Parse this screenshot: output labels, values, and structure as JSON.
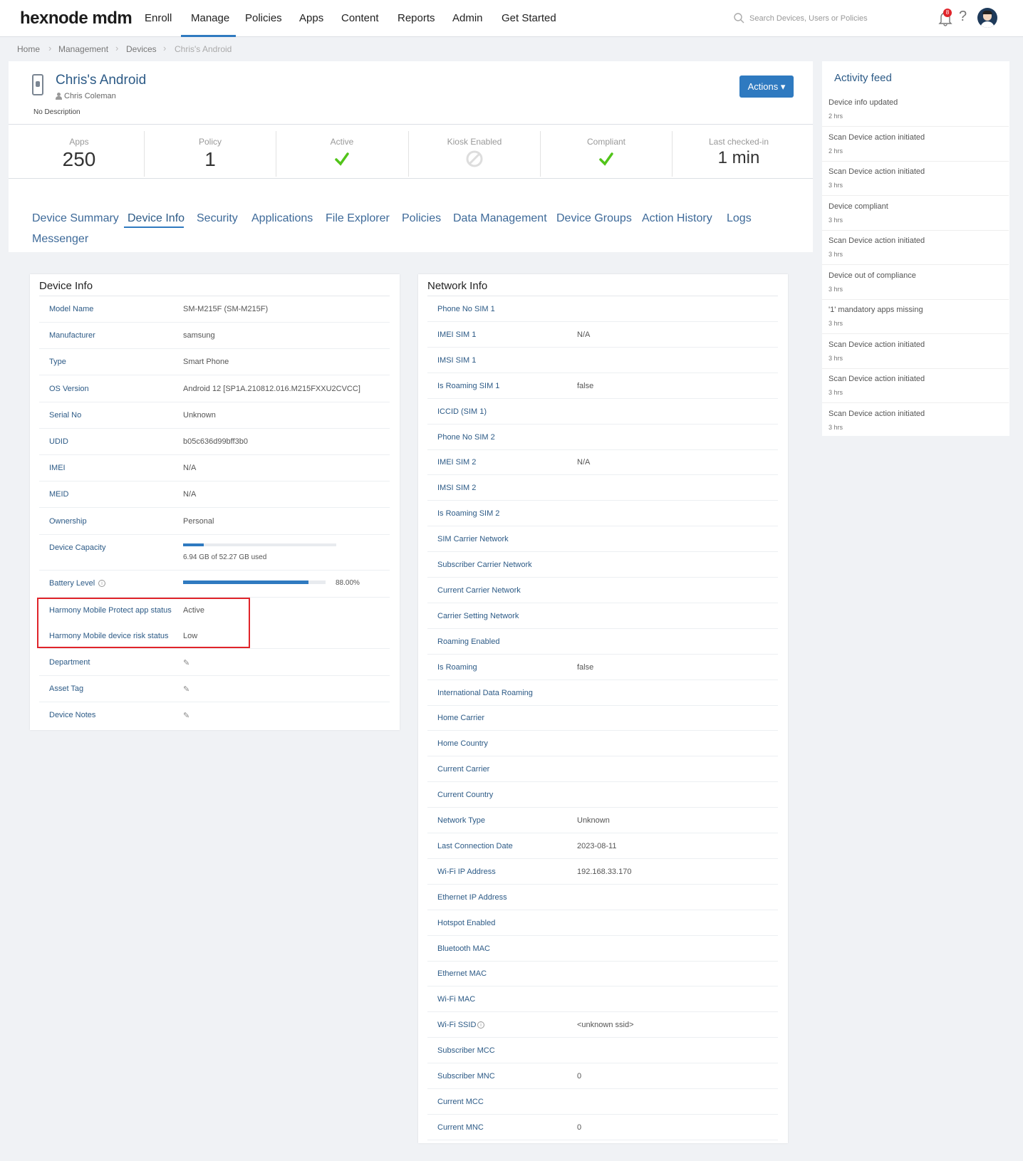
{
  "nav": {
    "logo": "hexnode mdm",
    "menu": [
      "Enroll",
      "Manage",
      "Policies",
      "Apps",
      "Content",
      "Reports",
      "Admin",
      "Get Started"
    ],
    "search_placeholder": "Search Devices, Users or Policies",
    "notification_count": "8"
  },
  "breadcrumb": [
    "Home",
    "Management",
    "Devices",
    "Chris's Android"
  ],
  "device": {
    "name": "Chris's Android",
    "user": "Chris Coleman",
    "description": "No Description",
    "actions_label": "Actions"
  },
  "stats": {
    "apps_label": "Apps",
    "apps_value": "250",
    "policy_label": "Policy",
    "policy_value": "1",
    "active_label": "Active",
    "kiosk_label": "Kiosk Enabled",
    "compliant_label": "Compliant",
    "checked_label": "Last checked-in",
    "checked_value": "1 min"
  },
  "tabs": [
    "Device Summary",
    "Device Info",
    "Security",
    "Applications",
    "File Explorer",
    "Policies",
    "Data Management",
    "Device Groups",
    "Action History",
    "Logs",
    "Messenger"
  ],
  "device_info": {
    "title": "Device Info",
    "rows": [
      {
        "k": "Model Name",
        "v": "SM-M215F (SM-M215F)"
      },
      {
        "k": "Manufacturer",
        "v": "samsung"
      },
      {
        "k": "Type",
        "v": "Smart Phone"
      },
      {
        "k": "OS Version",
        "v": "Android 12 [SP1A.210812.016.M215FXXU2CVCC]"
      },
      {
        "k": "Serial No",
        "v": "Unknown"
      },
      {
        "k": "UDID",
        "v": "b05c636d99bff3b0"
      },
      {
        "k": "IMEI",
        "v": "N/A"
      },
      {
        "k": "MEID",
        "v": "N/A"
      },
      {
        "k": "Ownership",
        "v": "Personal"
      }
    ],
    "capacity_label": "Device Capacity",
    "capacity_text": "6.94 GB of 52.27 GB used",
    "capacity_fraction": 0.133,
    "battery_label": "Battery Level",
    "battery_text": "88.00%",
    "battery_fraction": 0.88,
    "harmony_app_label": "Harmony Mobile Protect app status",
    "harmony_app_value": "Active",
    "harmony_risk_label": "Harmony Mobile device risk status",
    "harmony_risk_value": "Low",
    "department_label": "Department",
    "asset_label": "Asset Tag",
    "notes_label": "Device Notes"
  },
  "network_info": {
    "title": "Network Info",
    "rows": [
      {
        "k": "Phone No SIM 1",
        "v": ""
      },
      {
        "k": "IMEI SIM 1",
        "v": "N/A"
      },
      {
        "k": "IMSI SIM 1",
        "v": ""
      },
      {
        "k": "Is Roaming SIM 1",
        "v": "false"
      },
      {
        "k": "ICCID (SIM 1)",
        "v": ""
      },
      {
        "k": "Phone No SIM 2",
        "v": ""
      },
      {
        "k": "IMEI SIM 2",
        "v": "N/A"
      },
      {
        "k": "IMSI SIM 2",
        "v": ""
      },
      {
        "k": "Is Roaming SIM 2",
        "v": ""
      },
      {
        "k": "SIM Carrier Network",
        "v": ""
      },
      {
        "k": "Subscriber Carrier Network",
        "v": ""
      },
      {
        "k": "Current Carrier Network",
        "v": ""
      },
      {
        "k": "Carrier Setting Network",
        "v": ""
      },
      {
        "k": "Roaming Enabled",
        "v": ""
      },
      {
        "k": "Is Roaming",
        "v": "false"
      },
      {
        "k": "International Data Roaming",
        "v": ""
      },
      {
        "k": "Home Carrier",
        "v": ""
      },
      {
        "k": "Home Country",
        "v": ""
      },
      {
        "k": "Current Carrier",
        "v": ""
      },
      {
        "k": "Current Country",
        "v": ""
      },
      {
        "k": "Network Type",
        "v": "Unknown"
      },
      {
        "k": "Last Connection Date",
        "v": "2023-08-11"
      },
      {
        "k": "Wi-Fi IP Address",
        "v": "192.168.33.170"
      },
      {
        "k": "Ethernet IP Address",
        "v": ""
      },
      {
        "k": "Hotspot Enabled",
        "v": ""
      },
      {
        "k": "Bluetooth MAC",
        "v": ""
      },
      {
        "k": "Ethernet MAC",
        "v": ""
      },
      {
        "k": "Wi-Fi MAC",
        "v": ""
      },
      {
        "k": "Wi-Fi SSID",
        "v": "<unknown ssid>"
      },
      {
        "k": "Subscriber MCC",
        "v": ""
      },
      {
        "k": "Subscriber MNC",
        "v": "0"
      },
      {
        "k": "Current MCC",
        "v": ""
      },
      {
        "k": "Current MNC",
        "v": "0"
      }
    ]
  },
  "activity": {
    "title": "Activity feed",
    "items": [
      {
        "t": "Device info updated",
        "h": "2 hrs"
      },
      {
        "t": "Scan Device action initiated",
        "h": "2 hrs"
      },
      {
        "t": "Scan Device action initiated",
        "h": "3 hrs"
      },
      {
        "t": "Device compliant",
        "h": "3 hrs"
      },
      {
        "t": "Scan Device action initiated",
        "h": "3 hrs"
      },
      {
        "t": "Device out of compliance",
        "h": "3 hrs"
      },
      {
        "t": "'1' mandatory apps missing",
        "h": "3 hrs"
      },
      {
        "t": "Scan Device action initiated",
        "h": "3 hrs"
      },
      {
        "t": "Scan Device action initiated",
        "h": "3 hrs"
      },
      {
        "t": "Scan Device action initiated",
        "h": "3 hrs"
      }
    ]
  },
  "colors": {
    "accent": "#2f7ac0",
    "check": "#52c41a",
    "highlight": "#e0242a",
    "link": "#2c5a86"
  }
}
